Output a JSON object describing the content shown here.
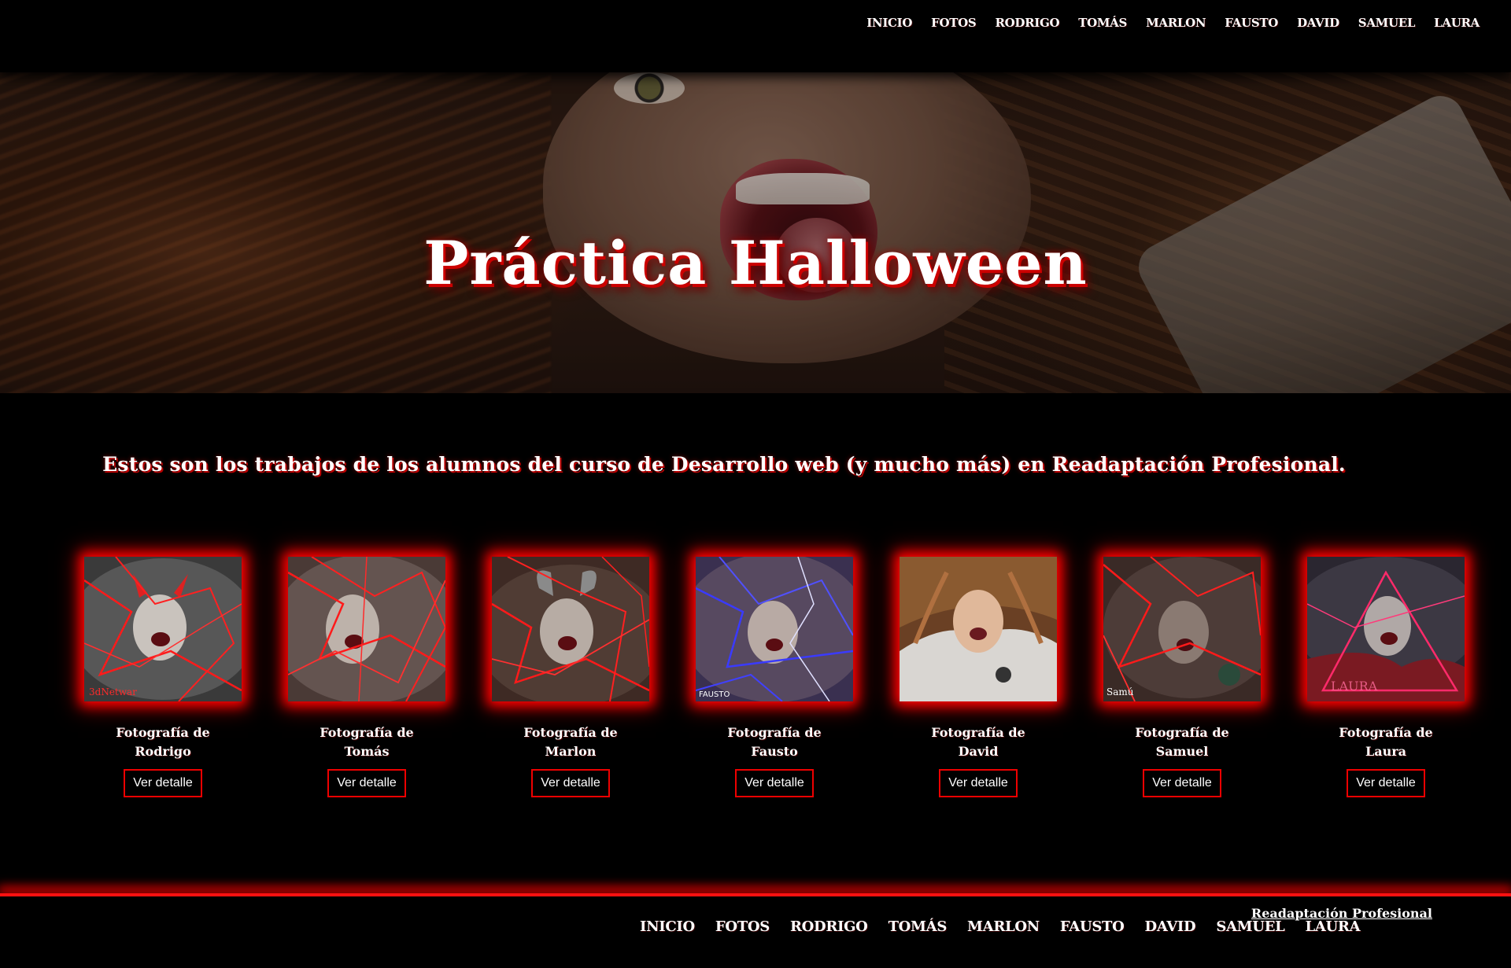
{
  "nav": {
    "items": [
      "Inicio",
      "Fotos",
      "Rodrigo",
      "Tomás",
      "Marlon",
      "Fausto",
      "David",
      "Samuel",
      "Laura"
    ]
  },
  "hero": {
    "title": "Práctica Halloween"
  },
  "intro": {
    "text": "Estos son los trabajos de los alumnos del curso de Desarrollo web (y mucho más) en Readaptación Profesional."
  },
  "gallery": {
    "cards": [
      {
        "label": "Fotografía de Rodrigo",
        "button": "Ver detalle",
        "watermark": "3dNetwar"
      },
      {
        "label": "Fotografía de Tomás",
        "button": "Ver detalle",
        "watermark": ""
      },
      {
        "label": "Fotografía de Marlon",
        "button": "Ver detalle",
        "watermark": ""
      },
      {
        "label": "Fotografía de Fausto",
        "button": "Ver detalle",
        "watermark": "FAUSTO"
      },
      {
        "label": "Fotografía de David",
        "button": "Ver detalle",
        "watermark": ""
      },
      {
        "label": "Fotografía de Samuel",
        "button": "Ver detalle",
        "watermark": "Samú"
      },
      {
        "label": "Fotografía de Laura",
        "button": "Ver detalle",
        "watermark": "LAURA"
      }
    ]
  },
  "footer": {
    "nav": [
      "Inicio",
      "Fotos",
      "Rodrigo",
      "Tomás",
      "Marlon",
      "Fausto",
      "David",
      "Samuel",
      "Laura"
    ],
    "credit": "Readaptación Profesional"
  },
  "colors": {
    "background": "#000000",
    "accent": "#ff0000",
    "text": "#ffffff"
  }
}
